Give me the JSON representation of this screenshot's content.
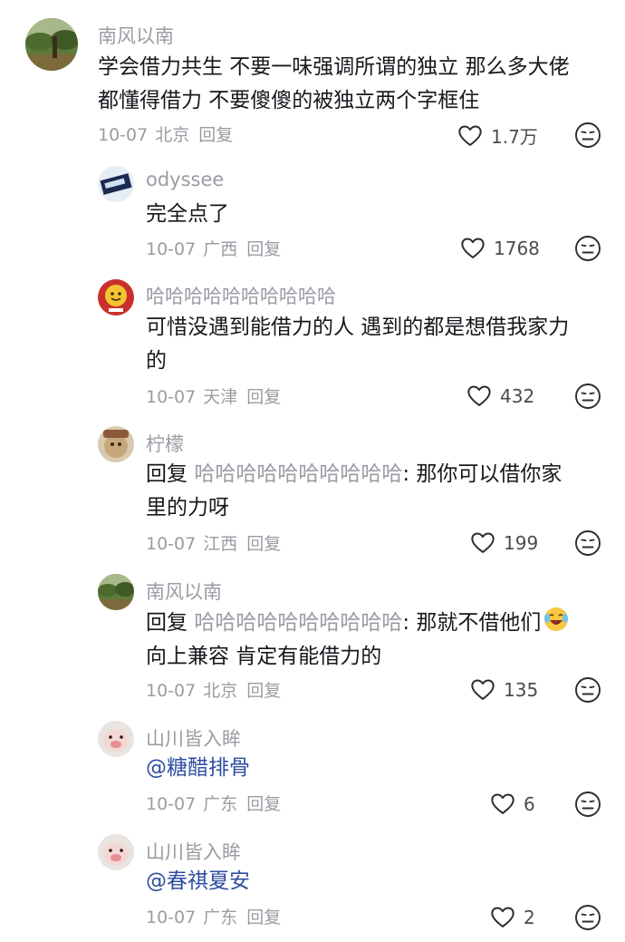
{
  "comments": [
    {
      "name": "南风以南",
      "line1": "学会借力共生 不要一味强调所谓的独立 那么多大佬",
      "line2": "都懂得借力 不要傻傻的被独立两个字框住",
      "date": "10-07",
      "location": "北京",
      "reply_label": "回复",
      "likes": "1.7万"
    },
    {
      "name": "odyssee",
      "line1": "完全点了",
      "date": "10-07",
      "location": "广西",
      "reply_label": "回复",
      "likes": "1768"
    },
    {
      "name": "哈哈哈哈哈哈哈哈哈哈",
      "line1": "可惜没遇到能借力的人 遇到的都是想借我家力",
      "line2": "的",
      "date": "10-07",
      "location": "天津",
      "reply_label": "回复",
      "likes": "432"
    },
    {
      "name": "柠檬",
      "reply_prefix": "回复 ",
      "reply_to": "哈哈哈哈哈哈哈哈哈哈",
      "line1_rest": ": 那你可以借你家",
      "line2": "里的力呀",
      "date": "10-07",
      "location": "江西",
      "reply_label": "回复",
      "likes": "199"
    },
    {
      "name": "南风以南",
      "reply_prefix": "回复 ",
      "reply_to": "哈哈哈哈哈哈哈哈哈哈",
      "line1_rest": ": 那就不借他们",
      "emoji": "crying-laughing-emoji",
      "line2": "向上兼容 肯定有能借力的",
      "date": "10-07",
      "location": "北京",
      "reply_label": "回复",
      "likes": "135"
    },
    {
      "name": "山川皆入眸",
      "mention": "@糖醋排骨",
      "date": "10-07",
      "location": "广东",
      "reply_label": "回复",
      "likes": "6"
    },
    {
      "name": "山川皆入眸",
      "mention": "@春祺夏安",
      "date": "10-07",
      "location": "广东",
      "reply_label": "回复",
      "likes": "2"
    }
  ],
  "colors": {
    "text": "#16181d",
    "secondary": "#9a9ca3",
    "mention": "#2f4ea0",
    "icon": "#2b2d33"
  }
}
